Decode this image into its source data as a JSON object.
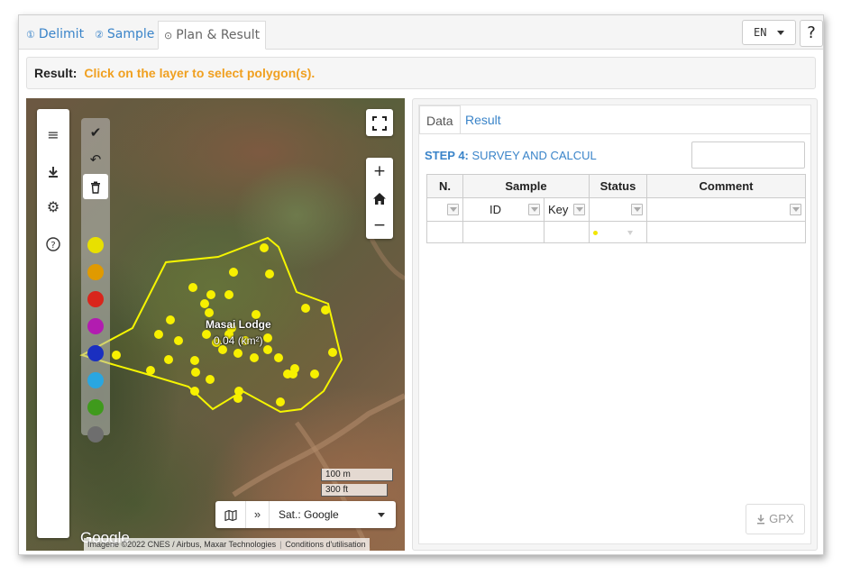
{
  "tabs": [
    {
      "num": "①",
      "label": "Delimit"
    },
    {
      "num": "②",
      "label": "Sample"
    },
    {
      "num": "⊙",
      "label": "Plan & Result"
    }
  ],
  "language": {
    "selected": "EN"
  },
  "help_label": "?",
  "result_bar": {
    "label": "Result:",
    "message": "Click on the layer to select polygon(s)."
  },
  "map": {
    "polygon": {
      "name": "Masai Lodge",
      "area": "0.04 (km²)"
    },
    "scale": {
      "metric": "100 m",
      "imperial": "300 ft"
    },
    "layer": {
      "selected": "Sat.: Google"
    },
    "logo": "Google",
    "attribution": "Imagerie ©2022 CNES / Airbus, Maxar Technologies",
    "terms": "Conditions d'utilisation",
    "colors": {
      "polygon": "#f5f500",
      "points": "#f7f000"
    },
    "swatch_colors": [
      "#e8e000",
      "#e09a00",
      "#d9251b",
      "#b21cb0",
      "#1a2fc0",
      "#2aa6e0",
      "#3f9a1c",
      "#6e6e6e"
    ],
    "icons": {
      "sidebar": [
        "menu-icon",
        "download-icon",
        "gear-icon",
        "help-circle-icon"
      ],
      "draw": [
        "check-icon",
        "undo-icon",
        "trash-icon"
      ],
      "controls": [
        "fullscreen-icon",
        "zoom-in-icon",
        "home-icon",
        "zoom-out-icon",
        "map-icon",
        "double-chevron-icon"
      ]
    }
  },
  "panel": {
    "tabs": [
      "Data",
      "Result"
    ],
    "step": {
      "label": "STEP 4:",
      "title": "SURVEY AND CALCUL"
    },
    "table": {
      "headers": [
        "N.",
        "Sample",
        "Status",
        "Comment"
      ],
      "subheaders": {
        "id": "ID",
        "key": "Key"
      }
    },
    "gpx_label": "GPX"
  }
}
